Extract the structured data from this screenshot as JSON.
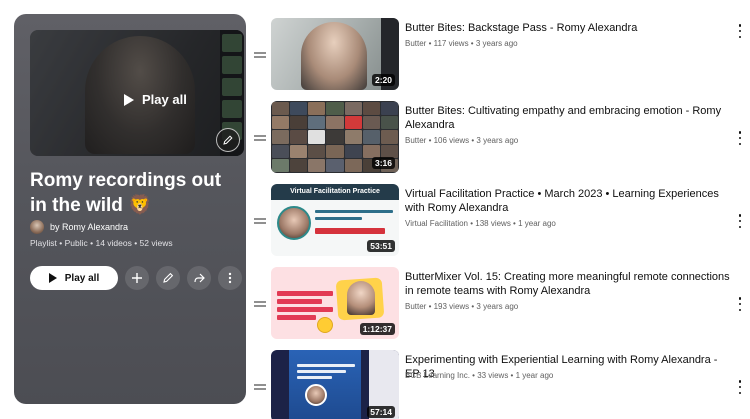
{
  "playlist": {
    "title": "Romy recordings out in the wild 🦁",
    "owner": "by Romy Alexandra",
    "meta": "Playlist • Public • 14 videos • 52 views",
    "hero_play_label": "Play all",
    "play_all_label": "Play all",
    "actions": [
      "plus-icon",
      "pencil-icon",
      "share-icon",
      "more-vert-icon"
    ]
  },
  "videos": [
    {
      "title": "Butter Bites: Backstage Pass - Romy Alexandra",
      "channel": "Butter",
      "views": "117 views",
      "age": "3 years ago",
      "duration": "2:20"
    },
    {
      "title": "Butter Bites: Cultivating empathy and embracing emotion - Romy Alexandra",
      "channel": "Butter",
      "views": "106 views",
      "age": "3 years ago",
      "duration": "3:16"
    },
    {
      "title": "Virtual Facilitation Practice • March 2023 • Learning Experiences with Romy Alexandra",
      "channel": "Virtual Facilitation",
      "views": "138 views",
      "age": "1 year ago",
      "duration": "53:51",
      "thumb_banner": "Virtual Facilitation Practice"
    },
    {
      "title": "ButterMixer Vol. 15: Creating more meaningful remote connections in remote teams with Romy Alexandra",
      "channel": "Butter",
      "views": "193 views",
      "age": "3 years ago",
      "duration": "1:12:37"
    },
    {
      "title": "Experimenting with Experiential Learning with Romy Alexandra - EP 13",
      "channel": "BCB Learning Inc.",
      "views": "33 views",
      "age": "1 year ago",
      "duration": "57:14"
    }
  ],
  "colors": {
    "panel": "#55565c",
    "text_primary": "#0f0f0f",
    "text_secondary": "#606060"
  }
}
